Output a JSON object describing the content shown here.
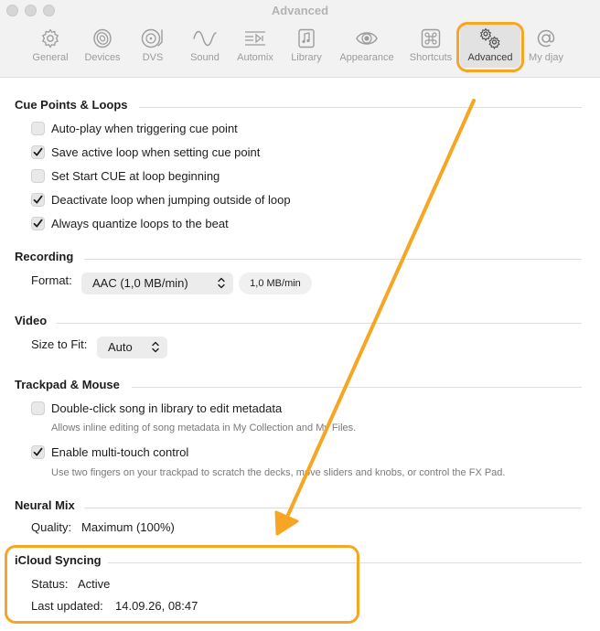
{
  "window": {
    "title": "Advanced"
  },
  "toolbar": {
    "tabs": [
      {
        "label": "General",
        "icon": "gear-icon"
      },
      {
        "label": "Devices",
        "icon": "speaker-icon"
      },
      {
        "label": "DVS",
        "icon": "turntable-icon"
      },
      {
        "label": "Sound",
        "icon": "waveform-icon"
      },
      {
        "label": "Automix",
        "icon": "automix-icon"
      },
      {
        "label": "Library",
        "icon": "music-library-icon"
      },
      {
        "label": "Appearance",
        "icon": "eye-icon"
      },
      {
        "label": "Shortcuts",
        "icon": "command-key-icon"
      },
      {
        "label": "Advanced",
        "icon": "gears-icon",
        "active": true
      },
      {
        "label": "My djay",
        "icon": "at-sign-icon"
      }
    ]
  },
  "cue": {
    "title": "Cue Points & Loops",
    "items": [
      {
        "label": "Auto-play when triggering cue point",
        "checked": false
      },
      {
        "label": "Save active loop when setting cue point",
        "checked": true
      },
      {
        "label": "Set Start CUE at loop beginning",
        "checked": false
      },
      {
        "label": "Deactivate loop when jumping outside of loop",
        "checked": true
      },
      {
        "label": "Always quantize loops to the beat",
        "checked": true
      }
    ]
  },
  "recording": {
    "title": "Recording",
    "format_label": "Format:",
    "format_value": "AAC (1,0 MB/min)",
    "size_badge": "1,0 MB/min"
  },
  "video": {
    "title": "Video",
    "size_label": "Size to Fit:",
    "size_value": "Auto"
  },
  "trackpad": {
    "title": "Trackpad & Mouse",
    "items": [
      {
        "label": "Double-click song in library to edit metadata",
        "checked": false,
        "hint": "Allows inline editing of song metadata in My Collection and My Files."
      },
      {
        "label": "Enable multi-touch control",
        "checked": true,
        "hint": "Use two fingers on your trackpad to scratch the decks, move sliders and knobs, or control the FX Pad."
      }
    ]
  },
  "neural": {
    "title": "Neural Mix",
    "quality_label": "Quality:",
    "quality_value": "Maximum (100%)"
  },
  "icloud": {
    "title": "iCloud Syncing",
    "status_label": "Status:",
    "status_value": "Active",
    "updated_label": "Last updated:",
    "updated_value": "14.09.26, 08:47"
  },
  "colors": {
    "annotation": "#f6a623",
    "icon": "#9c9c9c"
  }
}
